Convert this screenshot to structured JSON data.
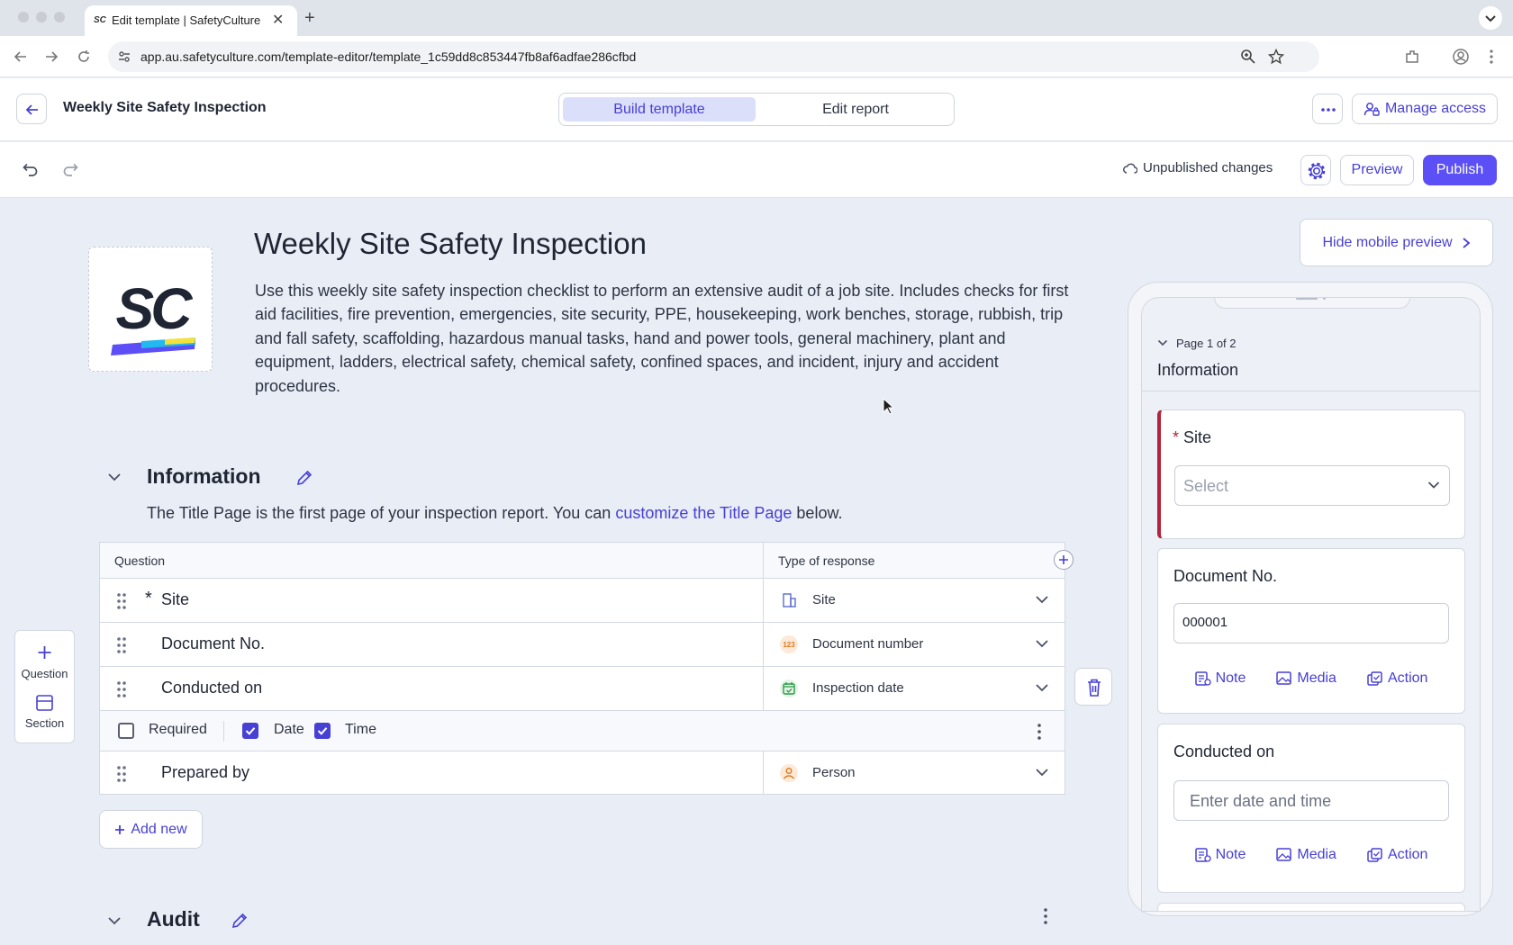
{
  "browser": {
    "tab_title": "Edit template | SafetyCulture",
    "favicon_text": "SC",
    "url": "app.au.safetyculture.com/template-editor/template_1c59dd8c853447fb8af6adfae286cfbd"
  },
  "header": {
    "title": "Weekly Site Safety Inspection",
    "tabs": [
      {
        "label": "Build template",
        "active": true
      },
      {
        "label": "Edit report",
        "active": false
      }
    ],
    "manage_access": "Manage access"
  },
  "editbar": {
    "status": "Unpublished changes",
    "preview": "Preview",
    "publish": "Publish"
  },
  "template": {
    "title": "Weekly Site Safety Inspection",
    "description": "Use this weekly site safety inspection checklist to perform an extensive audit of a job site. Includes checks for first aid facilities, fire prevention, emergencies, site security, PPE, housekeeping, work benches, storage, rubbish, trip and fall safety, scaffolding, hazardous manual tasks, hand and power tools, general machinery, plant and equipment, ladders, electrical safety, chemical safety, confined spaces, and incident, injury and accident procedures.",
    "hide_preview": "Hide mobile preview"
  },
  "section": {
    "title": "Information",
    "desc_before": "The Title Page is the first page of your inspection report. You can ",
    "desc_link": "customize the Title Page",
    "desc_after": " below.",
    "col_question": "Question",
    "col_type": "Type of response",
    "rows": [
      {
        "label": "Site",
        "required": true,
        "type": "Site",
        "icon": "site-icon"
      },
      {
        "label": "Document No.",
        "required": false,
        "type": "Document number",
        "icon": "number-icon",
        "icon_text": "123"
      },
      {
        "label": "Conducted on",
        "required": false,
        "type": "Inspection date",
        "icon": "calendar-icon"
      },
      {
        "label": "Prepared by",
        "required": false,
        "type": "Person",
        "icon": "person-icon"
      }
    ],
    "options": {
      "required": "Required",
      "date": "Date",
      "time": "Time"
    },
    "add_new": "Add new"
  },
  "audit": {
    "title": "Audit"
  },
  "side": {
    "question": "Question",
    "section": "Section"
  },
  "mobile": {
    "page_indicator": "Page 1 of 2",
    "section_title": "Information",
    "site_label": "Site",
    "site_placeholder": "Select",
    "docno_label": "Document No.",
    "docno_value": "000001",
    "conducted_label": "Conducted on",
    "conducted_placeholder": "Enter date and time",
    "note": "Note",
    "media": "Media",
    "action": "Action"
  },
  "colors": {
    "accent": "#4740d4",
    "publish": "#5b4ff5",
    "required_bar": "#b3243a"
  }
}
